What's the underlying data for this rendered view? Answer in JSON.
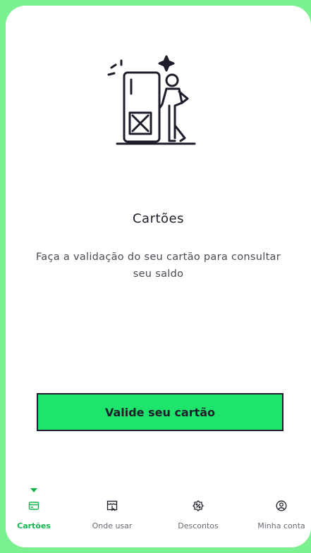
{
  "colors": {
    "background": "#7bf08f",
    "accent": "#14b54f",
    "button": "#1fe46b",
    "ink": "#1d1d2b"
  },
  "illustration": {
    "icon": "person-leaning-on-blocked-card-icon"
  },
  "title": "Cartões",
  "subtitle": "Faça a validação do seu cartão para consultar seu saldo",
  "cta": {
    "label": "Valide seu cartão"
  },
  "tabs": [
    {
      "label": "Cartões",
      "icon": "card-icon",
      "active": true
    },
    {
      "label": "Onde usar",
      "icon": "store-icon",
      "active": false
    },
    {
      "label": "Descontos",
      "icon": "discount-icon",
      "active": false
    },
    {
      "label": "Minha conta",
      "icon": "account-icon",
      "active": false
    }
  ]
}
